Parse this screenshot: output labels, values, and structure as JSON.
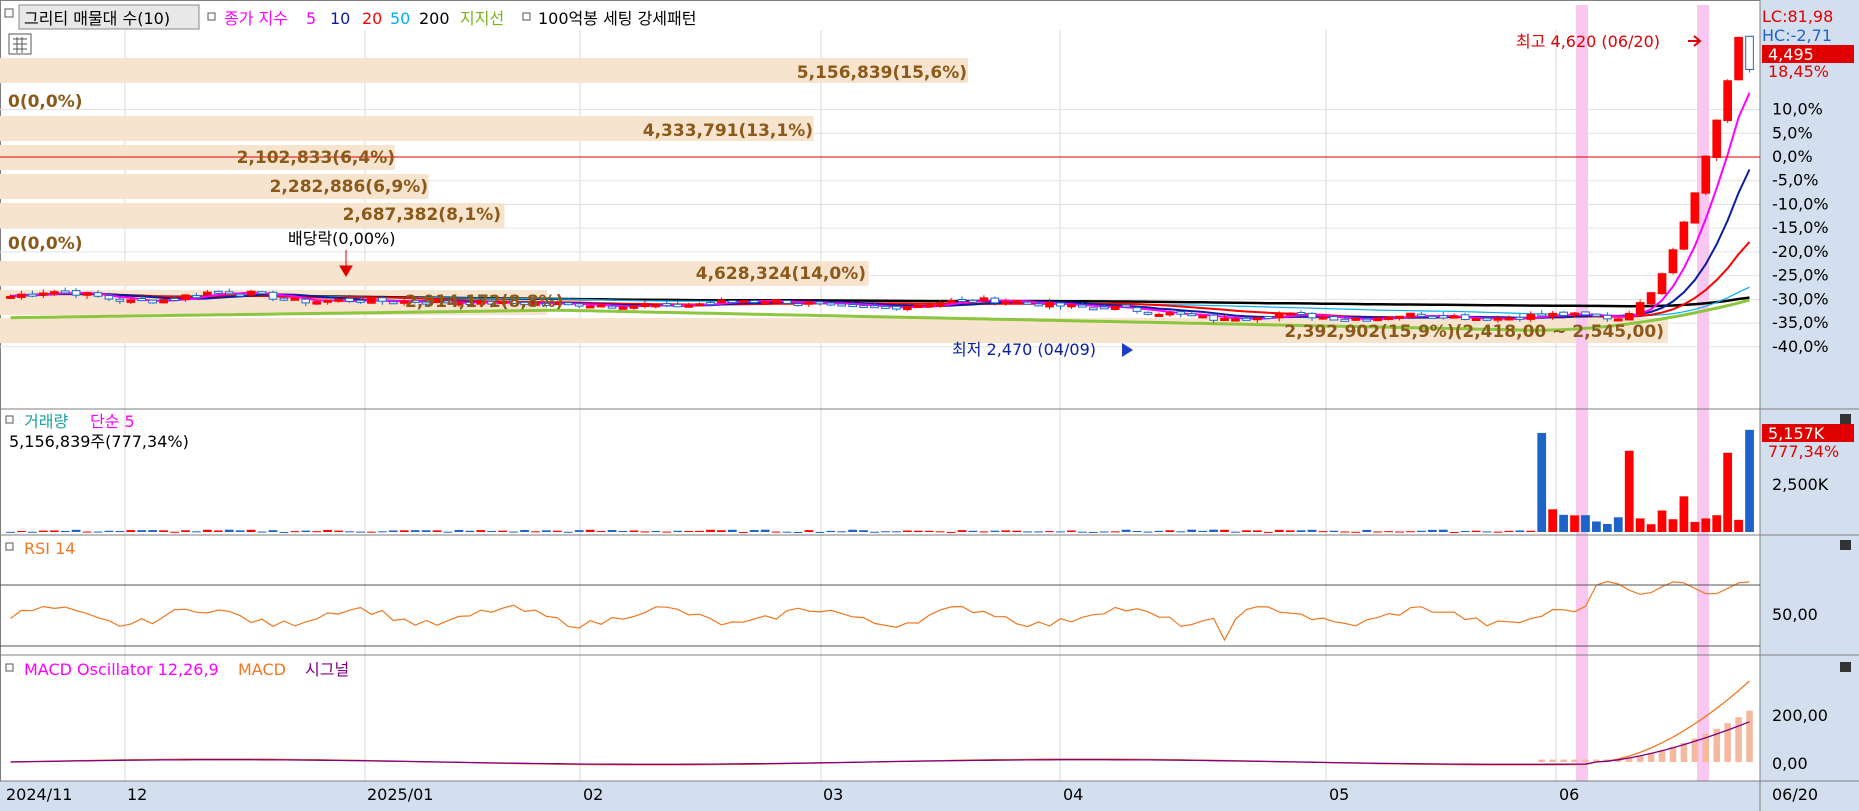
{
  "header": {
    "button_label": "그리티 매물대 수(10)",
    "ma_title": "종가 지수",
    "ma_periods": [
      "5",
      "10",
      "20",
      "50",
      "200"
    ],
    "ma_colors": [
      "#ff00ff",
      "#0a1ea0",
      "#ff0000",
      "#00b0f0",
      "#000000"
    ],
    "support_label": "지지선",
    "pattern_label": "100억봉 세팅 강세패턴"
  },
  "price_scale": {
    "lc": "LC:81,98",
    "hc": "HC:-2,71",
    "current_price": "4,495",
    "current_pct": "18,45%",
    "ticks": [
      "10,0%",
      "5,0%",
      "0,0%",
      "-5,0%",
      "-10,0%",
      "-15,0%",
      "-20,0%",
      "-25,0%",
      "-30,0%",
      "-35,0%",
      "-40,0%"
    ]
  },
  "annotations": {
    "high": "최고 4,620 (06/20)",
    "low": "최저 2,470 (04/09)",
    "dividend": "배당락(0,00%)",
    "last_band": "2,392,902(15,9%)(2,418,00 ~ 2,545,00)"
  },
  "volume_profile": {
    "labels": [
      "5,156,839(15,6%)",
      "0(0,0%)",
      "4,333,791(13,1%)",
      "2,102,833(6,4%)",
      "2,282,886(6,9%)",
      "2,687,382(8,1%)",
      "0(0,0%)",
      "4,628,324(14,0%)",
      "2,914,172(8,8%)"
    ],
    "values": [
      5156839,
      0,
      4333791,
      2102833,
      2282886,
      2687382,
      0,
      4628324,
      2914172
    ]
  },
  "volume_pane": {
    "title": "거래량",
    "ma_label": "단순 5",
    "info": "5,156,839주(777,34%)",
    "current": "5,157K",
    "current_pct": "777,34%",
    "tick": "2,500K"
  },
  "rsi_pane": {
    "title": "RSI 14",
    "tick": "50,00"
  },
  "macd_pane": {
    "title": "MACD Oscillator 12,26,9",
    "macd_label": "MACD",
    "signal_label": "시그널",
    "ticks": [
      "200,00",
      "0,00"
    ]
  },
  "x_axis": {
    "labels": [
      "2024/11",
      "12",
      "2025/01",
      "02",
      "03",
      "04",
      "05",
      "06"
    ],
    "end_label": "06/20"
  },
  "colors": {
    "up": "#ff0000",
    "down": "#1e64c8",
    "band": "#f7e4cf",
    "band_text": "#8b5a1a",
    "support": "#8cc63e",
    "highlight": "#f9c7f0",
    "axis_bg": "#d3dfee",
    "rsi": "#f07820",
    "macd": "#f07820",
    "signal": "#800080",
    "volume_ma": "#ff00ff"
  },
  "chart_data": [
    {
      "type": "line",
      "title": "",
      "x": [
        "2024/11",
        "12",
        "2025/01",
        "02",
        "03",
        "04",
        "05",
        "06",
        "06/20"
      ],
      "series": [
        {
          "name": "5",
          "values": [
            2650,
            2700,
            2660,
            2590,
            2640,
            2480,
            2560,
            2620,
            4330
          ]
        },
        {
          "name": "10",
          "values": [
            2660,
            2690,
            2670,
            2600,
            2650,
            2500,
            2570,
            2610,
            3760
          ]
        },
        {
          "name": "20",
          "values": [
            2680,
            2670,
            2680,
            2620,
            2650,
            2530,
            2570,
            2600,
            3450
          ]
        },
        {
          "name": "50",
          "values": [
            2700,
            2690,
            2670,
            2640,
            2630,
            2570,
            2580,
            2590,
            2950
          ]
        },
        {
          "name": "200",
          "values": [
            2720,
            2710,
            2690,
            2680,
            2670,
            2650,
            2630,
            2610,
            2820
          ]
        },
        {
          "name": "지지선",
          "values": [
            2510,
            2550,
            2570,
            2520,
            2500,
            2470,
            2420,
            2410,
            2830
          ]
        }
      ],
      "ylim": [
        2250,
        4750
      ]
    },
    {
      "type": "bar",
      "title": "",
      "categories": [
        "1",
        "2",
        "3",
        "4",
        "5",
        "6",
        "7",
        "8",
        "9"
      ],
      "values": [
        5156839,
        0,
        4333791,
        2102833,
        2282886,
        2687382,
        0,
        4628324,
        2914172
      ]
    }
  ]
}
